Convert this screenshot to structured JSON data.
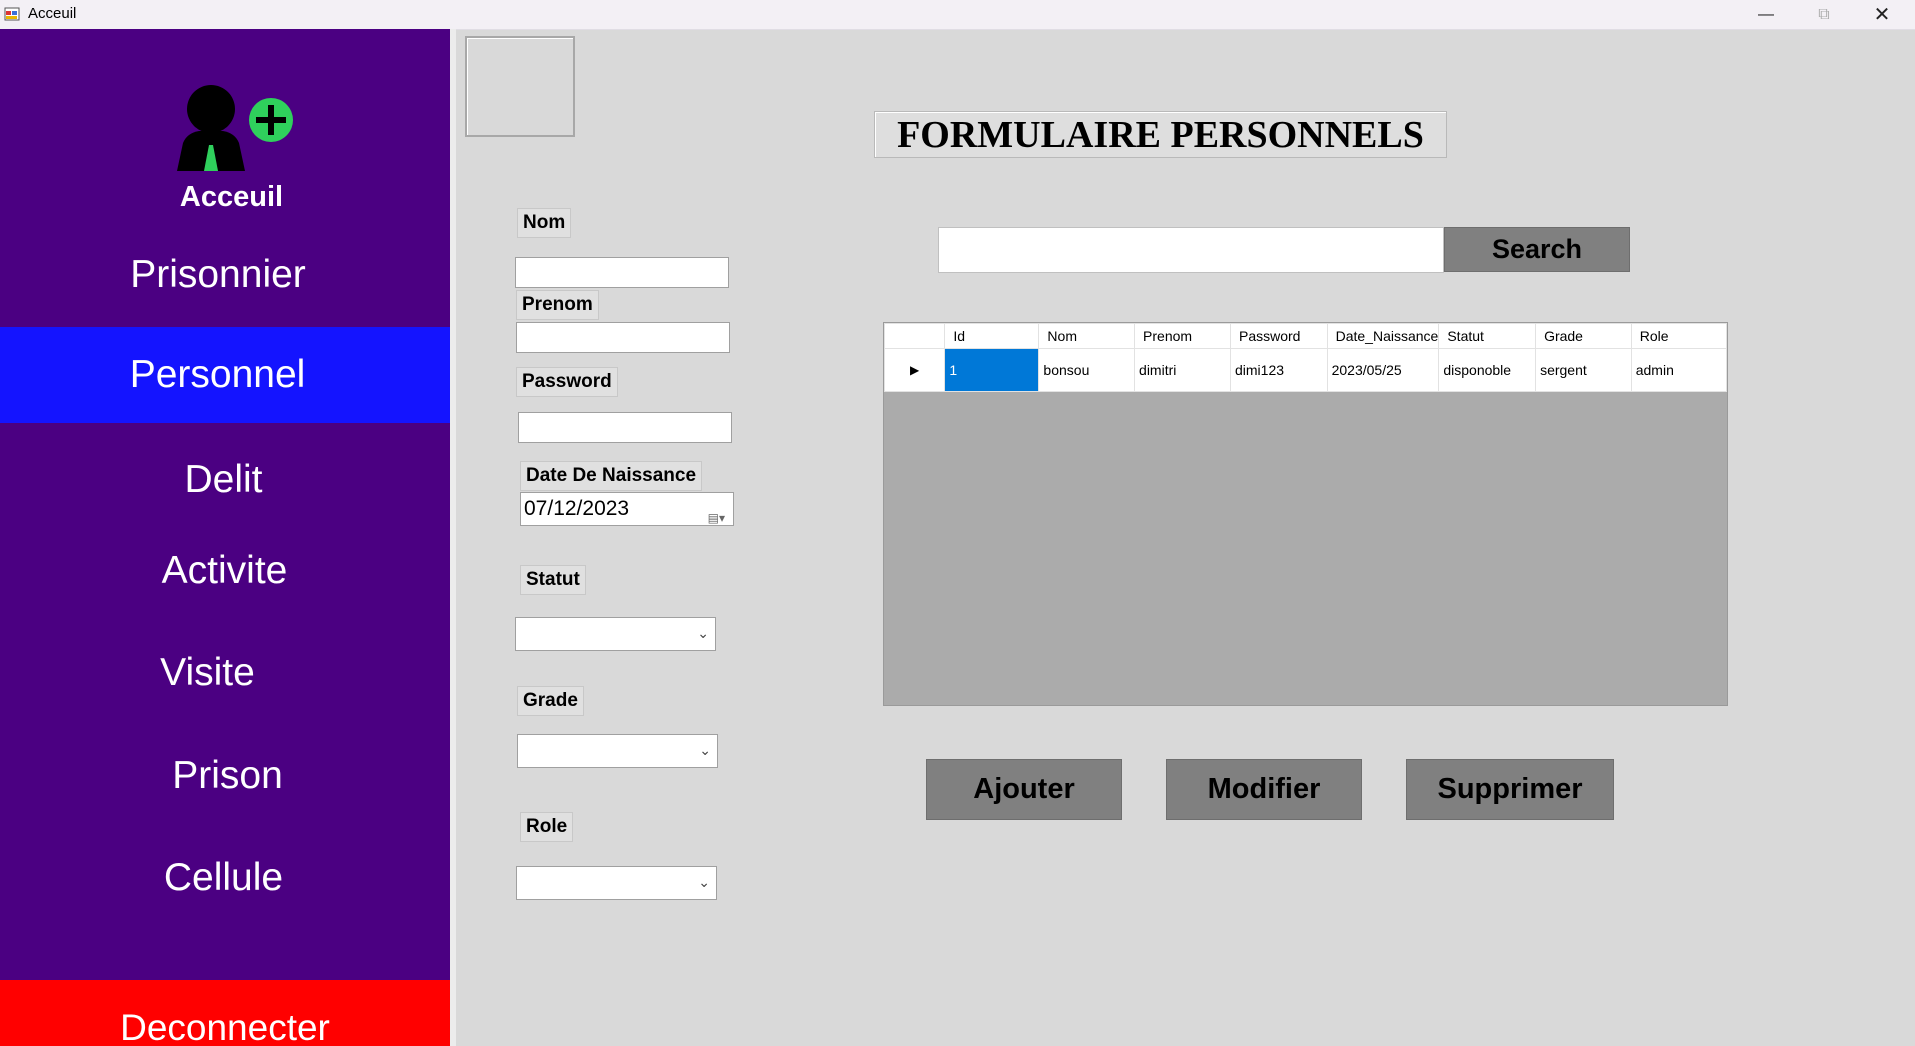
{
  "window": {
    "title": "Acceuil"
  },
  "sidebar": {
    "home_label": "Acceuil",
    "items": [
      {
        "label": "Prisonnier"
      },
      {
        "label": "Personnel"
      },
      {
        "label": "Delit"
      },
      {
        "label": "Activite"
      },
      {
        "label": "Visite"
      },
      {
        "label": "Prison"
      },
      {
        "label": "Cellule"
      }
    ],
    "active_item": "Personnel",
    "logout_label": "Deconnecter"
  },
  "form": {
    "title": "FORMULAIRE PERSONNELS",
    "nom_label": "Nom",
    "nom_value": "",
    "prenom_label": "Prenom",
    "prenom_value": "",
    "password_label": "Password",
    "password_value": "",
    "dob_label": "Date De Naissance",
    "dob_value": "07/12/2023",
    "statut_label": "Statut",
    "statut_value": "",
    "grade_label": "Grade",
    "grade_value": "",
    "role_label": "Role",
    "role_value": ""
  },
  "search": {
    "value": "",
    "button_label": "Search"
  },
  "table": {
    "columns": [
      "Id",
      "Nom",
      "Prenom",
      "Password",
      "Date_Naissance",
      "Statut",
      "Grade",
      "Role"
    ],
    "rows": [
      [
        "1",
        "bonsou",
        "dimitri",
        "dimi123",
        "2023/05/25",
        "disponoble",
        "sergent",
        "admin"
      ]
    ]
  },
  "actions": {
    "add_label": "Ajouter",
    "edit_label": "Modifier",
    "delete_label": "Supprimer"
  },
  "colors": {
    "sidebar": "#4b0082",
    "active": "#1414ff",
    "logout": "#ff0000",
    "selection": "#0078d7",
    "button": "#808080"
  }
}
